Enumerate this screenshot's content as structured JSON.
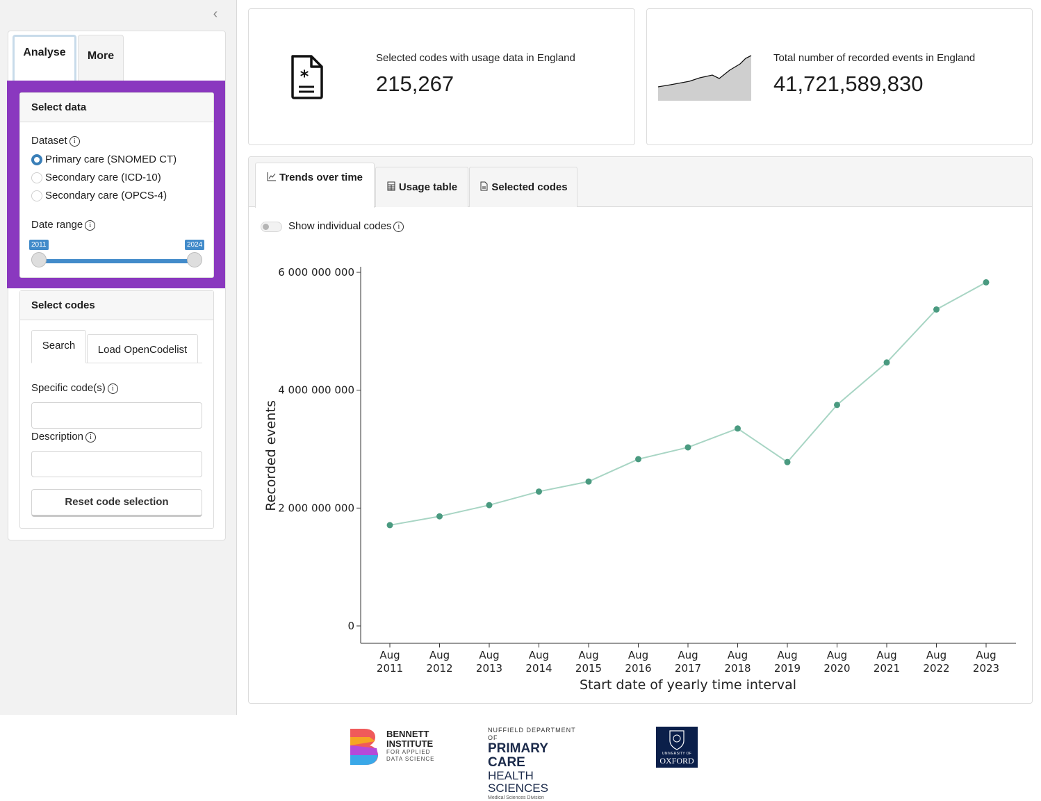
{
  "sidebar": {
    "tabs": [
      {
        "label": "Analyse"
      },
      {
        "label": "More"
      }
    ],
    "select_data": {
      "title": "Select data",
      "dataset_label": "Dataset",
      "datasets": [
        {
          "label": "Primary care (SNOMED CT)",
          "checked": true
        },
        {
          "label": "Secondary care (ICD-10)",
          "checked": false
        },
        {
          "label": "Secondary care (OPCS-4)",
          "checked": false
        }
      ],
      "date_range_label": "Date range",
      "date_from": "2011",
      "date_to": "2024"
    },
    "select_codes": {
      "title": "Select codes",
      "tabs": [
        {
          "label": "Search"
        },
        {
          "label": "Load OpenCodelist"
        }
      ],
      "specific_codes_label": "Specific code(s)",
      "specific_codes_value": "",
      "description_label": "Description",
      "description_value": "",
      "reset_label": "Reset code selection"
    }
  },
  "summary": {
    "codes": {
      "title": "Selected codes with usage data in England",
      "value": "215,267"
    },
    "events": {
      "title": "Total number of recorded events in England",
      "value": "41,721,589,830"
    }
  },
  "main": {
    "tabs": [
      {
        "label": "Trends over time",
        "icon": "line-chart-icon"
      },
      {
        "label": "Usage table",
        "icon": "table-icon"
      },
      {
        "label": "Selected codes",
        "icon": "document-icon"
      }
    ],
    "toggle_label": "Show individual codes"
  },
  "chart_data": {
    "type": "line",
    "title": "",
    "xlabel": "Start date of yearly time interval",
    "ylabel": "Recorded events",
    "categories": [
      "Aug 2011",
      "Aug 2012",
      "Aug 2013",
      "Aug 2014",
      "Aug 2015",
      "Aug 2016",
      "Aug 2017",
      "Aug 2018",
      "Aug 2019",
      "Aug 2020",
      "Aug 2021",
      "Aug 2022",
      "Aug 2023"
    ],
    "values": [
      1710000000,
      1860000000,
      2050000000,
      2280000000,
      2450000000,
      2830000000,
      3030000000,
      3350000000,
      2780000000,
      3750000000,
      4470000000,
      5370000000,
      5830000000
    ],
    "yticks": [
      0,
      2000000000,
      4000000000,
      6000000000
    ],
    "ytick_labels": [
      "0",
      "2 000 000 000",
      "4 000 000 000",
      "6 000 000 000"
    ],
    "ylim": [
      0,
      6000000000
    ],
    "line_color": "#a8d5c4",
    "marker_color": "#4a9a80",
    "grid": false,
    "legend": "none"
  },
  "footer": {
    "bennett": [
      "BENNETT",
      "INSTITUTE",
      "FOR APPLIED",
      "DATA SCIENCE"
    ],
    "nuffield": [
      "NUFFIELD DEPARTMENT OF",
      "PRIMARY CARE",
      "HEALTH SCIENCES",
      "Medical Sciences Division"
    ],
    "oxford": [
      "UNIVERSITY OF",
      "OXFORD"
    ]
  },
  "colors": {
    "accent": "#428bca",
    "highlight": "#8a38bf"
  }
}
